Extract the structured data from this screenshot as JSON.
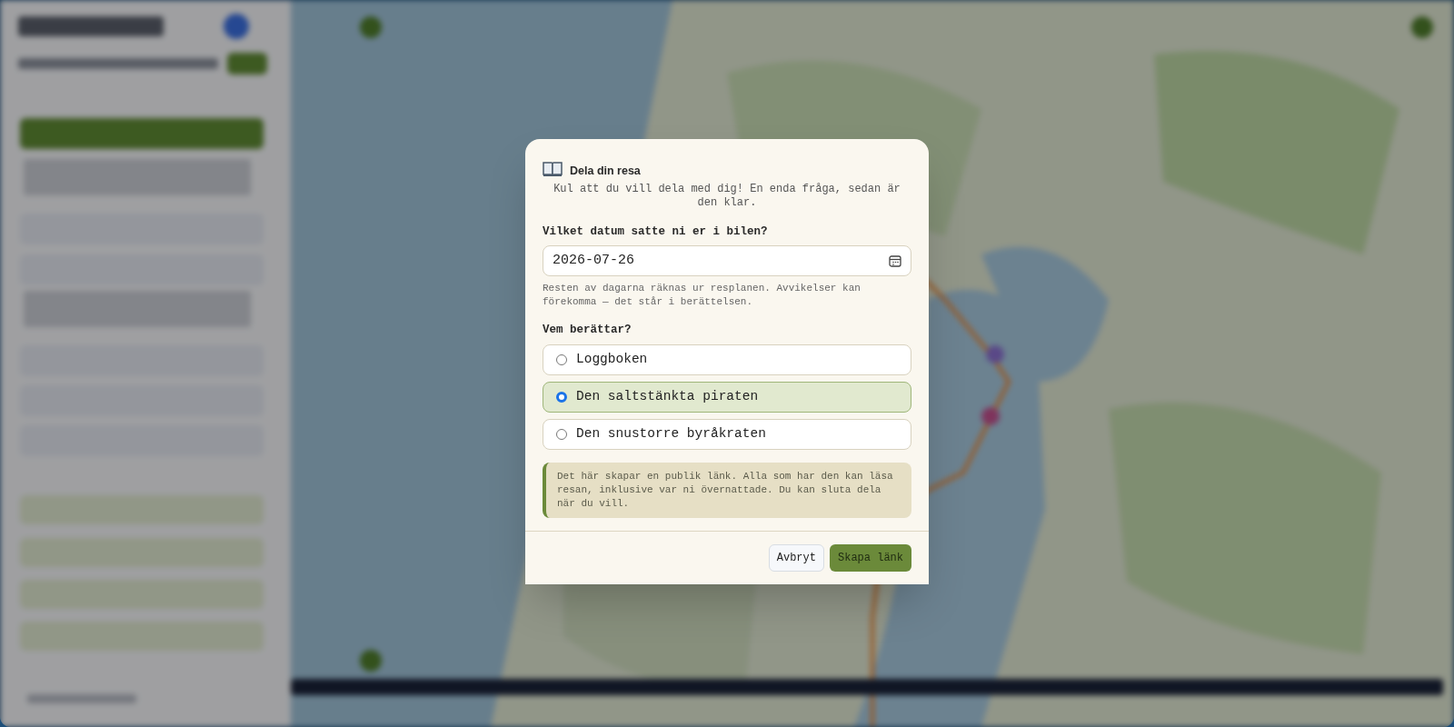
{
  "dialog": {
    "title": "Dela din resa",
    "subtitle": "Kul att du vill dela med dig! En enda fråga, sedan är den klar.",
    "date_label": "Vilket datum satte ni er i bilen?",
    "date_value": "2026-07-26",
    "date_hint": "Resten av dagarna räknas ur resplanen. Avvikelser kan förekomma — det står i berättelsen.",
    "narrator_label": "Vem berättar?",
    "narrators": [
      {
        "label": "Loggboken",
        "selected": false
      },
      {
        "label": "Den saltstänkta piraten",
        "selected": true
      },
      {
        "label": "Den snustorre byråkraten",
        "selected": false
      }
    ],
    "notice": "Det här skapar en publik länk. Alla som har den kan läsa resan, inklusive var ni övernattade. Du kan sluta dela när du vill.",
    "buttons": [
      {
        "label": "Avbryt",
        "kind": "secondary"
      },
      {
        "label": "Skapa länk",
        "kind": "primary"
      }
    ]
  }
}
